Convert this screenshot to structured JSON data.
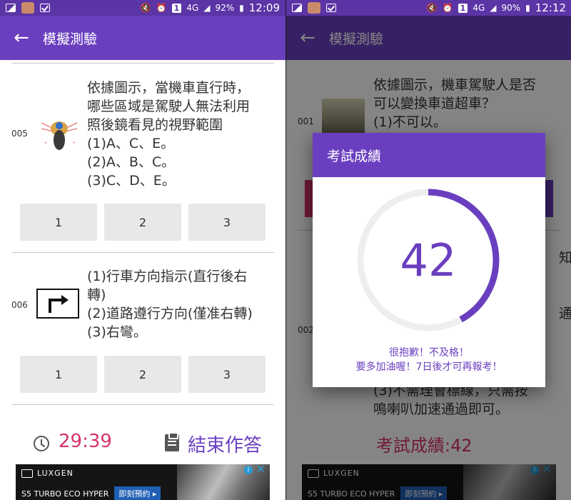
{
  "status_left": {
    "battery": "92%",
    "time": "12:09",
    "sim": "1",
    "net": "4G"
  },
  "status_right": {
    "battery": "90%",
    "time": "12:12",
    "sim": "1",
    "net": "4G"
  },
  "appbar": {
    "title": "模擬測驗"
  },
  "left": {
    "q005": {
      "number": "005",
      "lines": [
        "依據圖示，當機車直行時，",
        "哪些區域是駕駛人無法利用",
        "照後鏡看見的視野範圍",
        "(1)A、C、E。",
        "(2)A、B、C。",
        "(3)C、D、E。"
      ],
      "answers": [
        "1",
        "2",
        "3"
      ]
    },
    "q006": {
      "number": "006",
      "lines": [
        "(1)行車方向指示(直行後右",
        "轉)",
        "(2)道路遵行方向(僅准右轉)",
        "(3)右彎。"
      ],
      "answers": [
        "1",
        "2",
        "3"
      ]
    },
    "timer": "29:39",
    "end_label": "結束作答"
  },
  "right": {
    "q001": {
      "number": "001",
      "lines": [
        "依據圖示，機車駕駛人是否",
        "可以變換車道超車？",
        "(1)不可以。"
      ]
    },
    "q002": {
      "number": "002"
    },
    "partial": {
      "l1": "知",
      "l2": "通",
      "l3": "(3)不需理會標線，只需按",
      "l4": "鳴喇叭加速通過即可。"
    },
    "score_label": "考試成績:42"
  },
  "dialog": {
    "title": "考試成績",
    "score": "42",
    "score_fraction": 0.42,
    "message_1": "很抱歉！不及格！",
    "message_2": "要多加油喔！7日後才可再報考！"
  },
  "ad": {
    "brand": "LUXGEN",
    "model": "S5 TURBO ECO HYPER",
    "cta": "即刻預約 ▸",
    "info": "i",
    "close": "✕"
  },
  "colors": {
    "primary": "#6a3fbf",
    "primary_dark": "#5b34a6",
    "accent": "#d6336c",
    "button_bg": "#e8e8e8"
  }
}
